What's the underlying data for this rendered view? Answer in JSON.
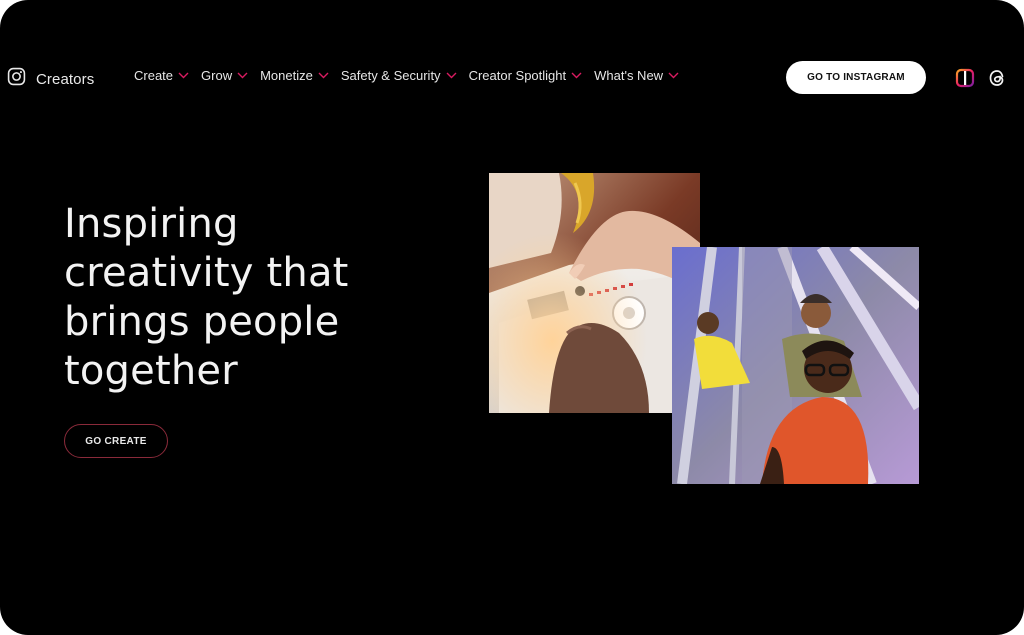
{
  "brand": {
    "name": "Creators"
  },
  "nav": {
    "items": [
      {
        "label": "Create"
      },
      {
        "label": "Grow"
      },
      {
        "label": "Monetize"
      },
      {
        "label": "Safety & Security"
      },
      {
        "label": "Creator Spotlight"
      },
      {
        "label": "What's New"
      }
    ],
    "cta_label": "GO TO INSTAGRAM"
  },
  "hero": {
    "title_lines": [
      "Inspiring",
      "creativity that",
      "brings people",
      "together"
    ],
    "button_label": "GO CREATE"
  },
  "icons": {
    "brand": "instagram-icon",
    "chevron": "chevron-down-icon",
    "edits": "edits-app-icon",
    "threads": "threads-icon"
  },
  "colors": {
    "background": "#000000",
    "accent": "#c2185b",
    "button_bg": "#ffffff"
  }
}
